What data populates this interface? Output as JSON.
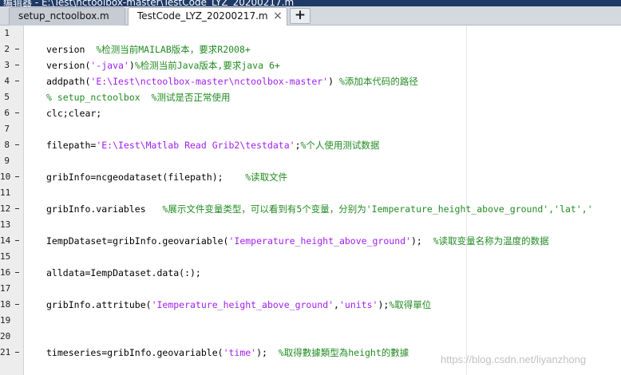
{
  "window": {
    "title_partial": "编辑器 - E:\\Test\\nctoolbox-master\\TestCode_LYZ_20200217.m"
  },
  "tabs": [
    {
      "label": "setup_nctoolbox.m",
      "active": false
    },
    {
      "label": "TestCode_LYZ_20200217.m",
      "active": true
    }
  ],
  "new_tab_label": "+",
  "close_glyph": "×",
  "colors": {
    "string": "#a020f0",
    "comment": "#228b22",
    "keyword": "#000000"
  },
  "lines": [
    {
      "num": "1",
      "dash": false,
      "parts": []
    },
    {
      "num": "2",
      "dash": true,
      "parts": [
        {
          "t": "version  ",
          "c": ""
        },
        {
          "t": "%检测当前MAILAB版本，要求R2008+",
          "c": "cmt"
        }
      ]
    },
    {
      "num": "3",
      "dash": true,
      "parts": [
        {
          "t": "version(",
          "c": ""
        },
        {
          "t": "'-java'",
          "c": "str"
        },
        {
          "t": ")",
          "c": ""
        },
        {
          "t": "%检测当前Java版本,要求java 6+",
          "c": "cmt"
        }
      ]
    },
    {
      "num": "4",
      "dash": true,
      "parts": [
        {
          "t": "addpath(",
          "c": ""
        },
        {
          "t": "'E:\\Iest\\nctoolbox-master\\nctoolbox-master'",
          "c": "str"
        },
        {
          "t": ") ",
          "c": ""
        },
        {
          "t": "%添加本代码的路径",
          "c": "cmt"
        }
      ]
    },
    {
      "num": "5",
      "dash": false,
      "parts": [
        {
          "t": "% setup_nctoolbox  %测试是否正常使用",
          "c": "cmt"
        }
      ]
    },
    {
      "num": "6",
      "dash": true,
      "parts": [
        {
          "t": "clc;clear;",
          "c": ""
        }
      ]
    },
    {
      "num": "7",
      "dash": false,
      "parts": []
    },
    {
      "num": "8",
      "dash": true,
      "parts": [
        {
          "t": "filepath=",
          "c": ""
        },
        {
          "t": "'E:\\Iest\\Matlab Read Grib2\\testdata'",
          "c": "str"
        },
        {
          "t": ";",
          "c": ""
        },
        {
          "t": "%个人使用测试数据",
          "c": "cmt"
        }
      ]
    },
    {
      "num": "9",
      "dash": false,
      "parts": []
    },
    {
      "num": "10",
      "dash": true,
      "parts": [
        {
          "t": "gribInfo=ncgeodataset(filepath);    ",
          "c": ""
        },
        {
          "t": "%读取文件",
          "c": "cmt"
        }
      ]
    },
    {
      "num": "11",
      "dash": false,
      "parts": []
    },
    {
      "num": "12",
      "dash": true,
      "parts": [
        {
          "t": "gribInfo.variables   ",
          "c": ""
        },
        {
          "t": "%展示文件变量类型，可以看到有5个变量，分别为'Iemperature_height_above_ground','lat','",
          "c": "cmt"
        }
      ]
    },
    {
      "num": "13",
      "dash": false,
      "parts": []
    },
    {
      "num": "14",
      "dash": true,
      "parts": [
        {
          "t": "IempDataset=gribInfo.geovariable(",
          "c": ""
        },
        {
          "t": "'Iemperature_height_above_ground'",
          "c": "str"
        },
        {
          "t": ");  ",
          "c": ""
        },
        {
          "t": "%读取变量名称为温度的数据",
          "c": "cmt"
        }
      ]
    },
    {
      "num": "15",
      "dash": false,
      "parts": []
    },
    {
      "num": "16",
      "dash": true,
      "parts": [
        {
          "t": "alldata=IempDataset.data(:);",
          "c": ""
        }
      ]
    },
    {
      "num": "17",
      "dash": false,
      "parts": []
    },
    {
      "num": "18",
      "dash": true,
      "parts": [
        {
          "t": "gribInfo.attritube(",
          "c": ""
        },
        {
          "t": "'Iemperature_height_above_ground'",
          "c": "str"
        },
        {
          "t": ",",
          "c": ""
        },
        {
          "t": "'units'",
          "c": "str"
        },
        {
          "t": ");",
          "c": ""
        },
        {
          "t": "%取得單位",
          "c": "cmt"
        }
      ]
    },
    {
      "num": "19",
      "dash": false,
      "parts": []
    },
    {
      "num": "20",
      "dash": false,
      "parts": []
    },
    {
      "num": "21",
      "dash": true,
      "parts": [
        {
          "t": "timeseries=gribInfo.geovariable(",
          "c": ""
        },
        {
          "t": "'time'",
          "c": "str"
        },
        {
          "t": ");  ",
          "c": ""
        },
        {
          "t": "%取得數據類型為height的數據",
          "c": "cmt"
        }
      ]
    }
  ],
  "watermark": "https://blog.csdn.net/liyanzhong"
}
